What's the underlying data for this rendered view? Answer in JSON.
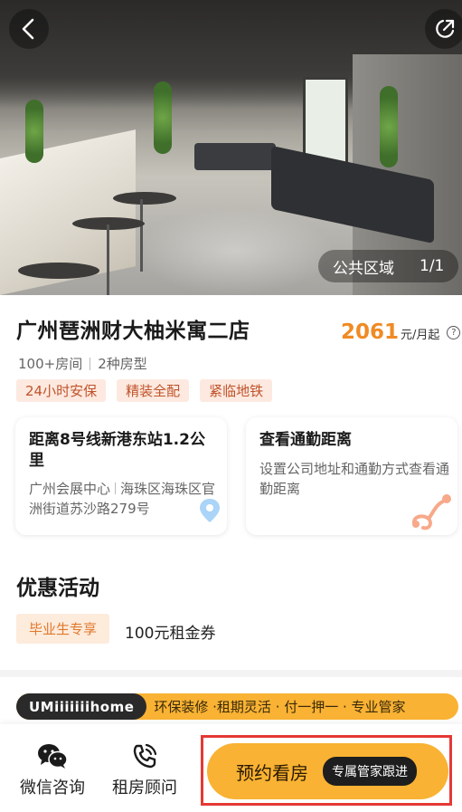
{
  "hero": {
    "photo_label": "公共区域",
    "photo_index": "1/1"
  },
  "apartment": {
    "name": "广州琶洲财大柚米寓二店",
    "price": "2061",
    "price_unit": "元/月起",
    "help_symbol": "?",
    "rooms": "100+房间",
    "room_types": "2种房型",
    "tags": [
      "24小时安保",
      "精装全配",
      "紧临地铁"
    ]
  },
  "location_card": {
    "title": "距离8号线新港东站1.2公里",
    "area": "广州会展中心",
    "address": "海珠区海珠区官洲街道苏沙路279号"
  },
  "commute_card": {
    "title": "查看通勤距离",
    "desc": "设置公司地址和通勤方式查看通勤距离"
  },
  "promotions": {
    "title": "优惠活动",
    "badge": "毕业生专享",
    "text": "100元租金券"
  },
  "brand": {
    "logo": "UMiiiiiiihome",
    "slogan": "环保装修 ·租期灵活 · 付一押一 · 专业管家"
  },
  "bottom_bar": {
    "wechat_label": "微信咨询",
    "consultant_label": "租房顾问",
    "book_label": "预约看房",
    "book_badge": "专属管家跟进"
  },
  "colors": {
    "accent": "#f9b233",
    "price": "#f08a24",
    "tag_text": "#c0532a",
    "tag_bg": "#fde9e0",
    "highlight_border": "#e53935"
  },
  "icons": [
    "back-arrow-icon",
    "share-icon",
    "location-pin-icon",
    "route-icon",
    "wechat-icon",
    "phone-icon"
  ]
}
